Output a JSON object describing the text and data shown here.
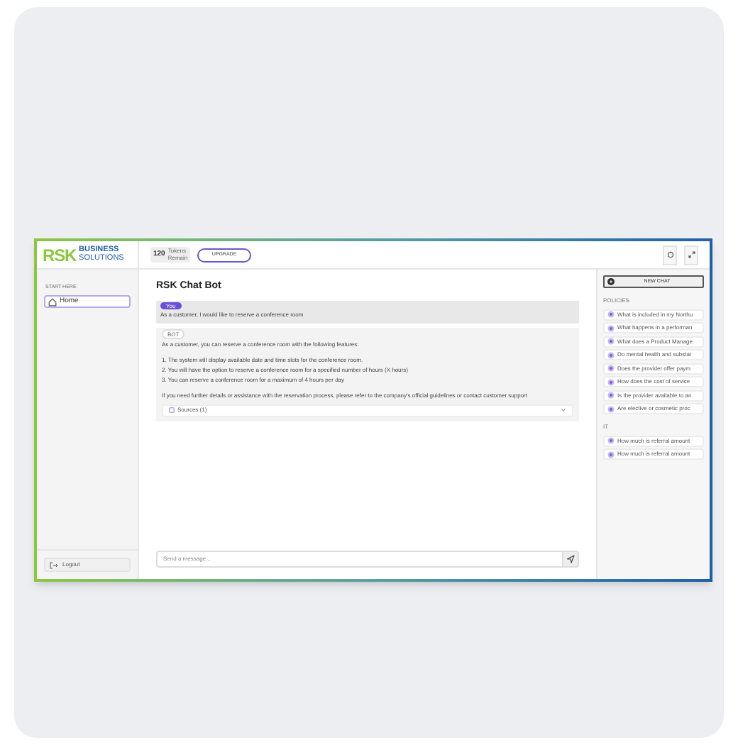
{
  "logo": {
    "mark": "RSK",
    "line1": "BUSINESS",
    "line2": "SOLUTIONS"
  },
  "sidebar": {
    "section": "START HERE",
    "items": [
      {
        "label": "Home",
        "selected": true
      }
    ],
    "logout": "Logout"
  },
  "header": {
    "tokens": "120",
    "tokens_label": "Tokens Remain",
    "upgrade": "UPGRADE"
  },
  "chat": {
    "title": "RSK Chat Bot",
    "messages": [
      {
        "kind": "user",
        "author": "You",
        "text": "As a customer, I would like to reserve a conference room"
      },
      {
        "kind": "bot",
        "author": "BOT",
        "intro": "As a customer, you can reserve a conference room with the following features:",
        "points": [
          "1. The system will display available date and time slots for the conference room.",
          "2. You will have the option to reserve a conference room for a specified number of hours (X hours)",
          "3. You can reserve a conference room for a maximum of 4 hours per day"
        ],
        "closing": "If you need further details or assistance with the reservation process, please refer to the company's official guidelines or contact customer support",
        "sources": "Sources (1)",
        "sources_expanded": false
      }
    ],
    "input_placeholder": "Send a message..."
  },
  "right_panel": {
    "new_chat": "NEW CHAT",
    "sections": [
      {
        "title": "POLICIES",
        "questions": [
          "What is included in my Northu",
          "What happens in a performan",
          "What does a Product Manage",
          "Do mental health and substar",
          "Does the provider offer paym",
          "How does the cost of service",
          "Is the provider available to an",
          "Are elective or cosmetic proc"
        ]
      },
      {
        "title": "IT",
        "questions": [
          "How much is referral amount",
          "How much is referral amount"
        ]
      }
    ]
  }
}
